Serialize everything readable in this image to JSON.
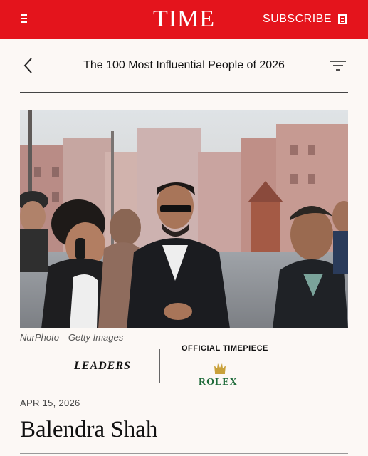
{
  "header": {
    "logo": "TIME",
    "subscribe_label": "SUBSCRIBE",
    "menu_icon": "hamburger-menu-icon",
    "subscribe_icon": "magazine-icon",
    "background_color": "#e4141c"
  },
  "nav": {
    "title": "The 100 Most Influential People of 2026",
    "back_icon": "chevron-left-icon",
    "filter_icon": "filter-icon"
  },
  "photo": {
    "caption": "NurPhoto—Getty Images"
  },
  "category": {
    "label": "LEADERS"
  },
  "sponsor": {
    "heading": "OFFICIAL TIMEPIECE",
    "brand": "ROLEX",
    "brand_color": "#1f6b3a"
  },
  "article": {
    "date": "APR 15, 2026",
    "name": "Balendra Shah"
  }
}
